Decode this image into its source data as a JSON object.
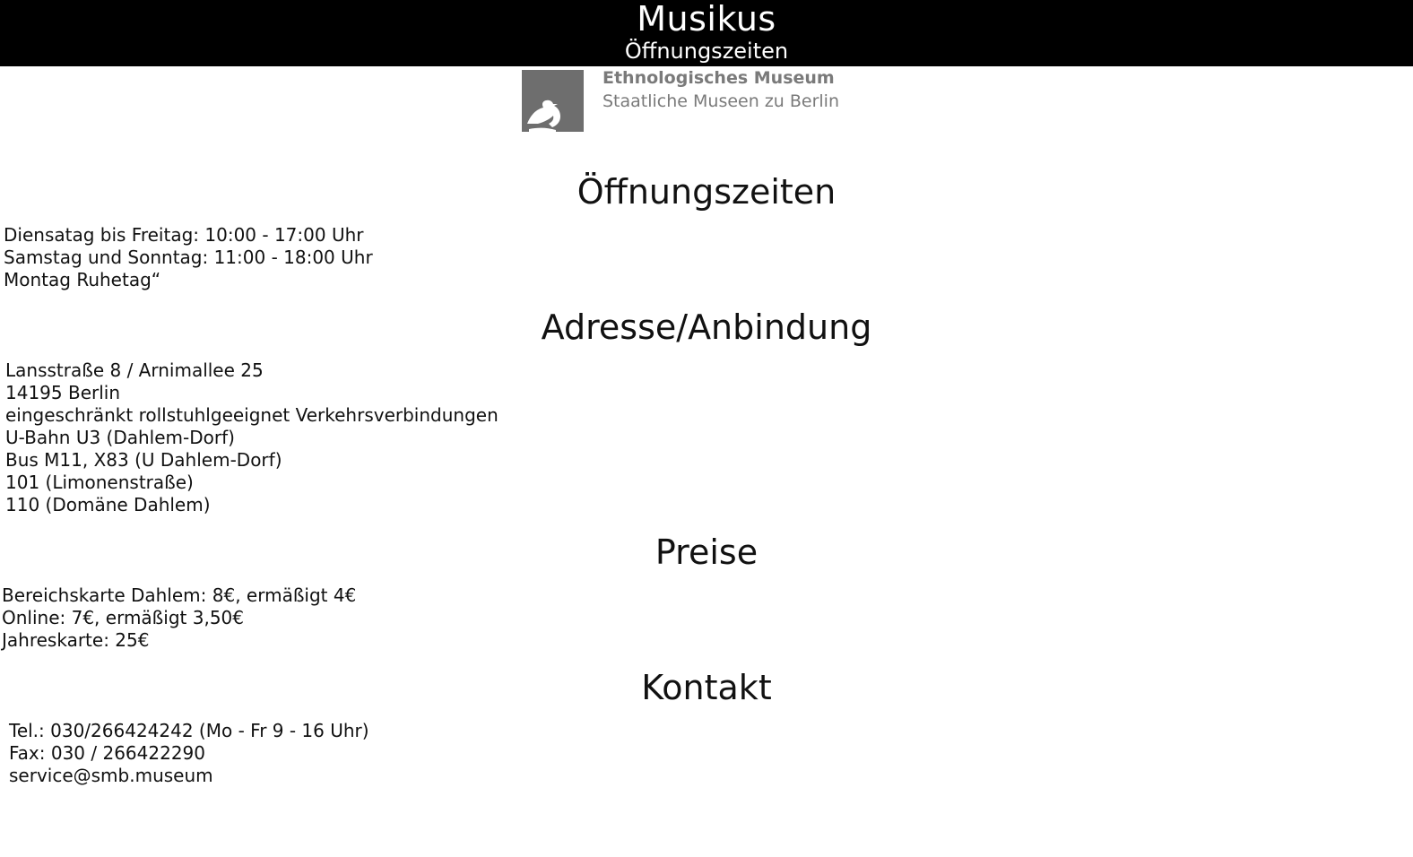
{
  "header": {
    "title": "Musikus",
    "subtitle": "Öffnungszeiten"
  },
  "logo": {
    "name": "Ethnologisches Museum",
    "organization": "Staatliche Museen zu Berlin",
    "icon": "eagle-logo-icon"
  },
  "sections": {
    "hours": {
      "heading": "Öffnungszeiten",
      "lines": [
        "Diensatag bis Freitag: 10:00 - 17:00 Uhr",
        "Samstag und Sonntag: 11:00 - 18:00 Uhr",
        "Montag Ruhetag“"
      ]
    },
    "address": {
      "heading": "Adresse/Anbindung",
      "lines": [
        "Lansstraße 8 / Arnimallee 25",
        "14195 Berlin",
        "eingeschränkt rollstuhlgeeignet Verkehrsverbindungen",
        "U-Bahn U3 (Dahlem-Dorf)",
        "Bus M11, X83 (U Dahlem-Dorf)",
        "101 (Limonenstraße)",
        "110 (Domäne Dahlem)"
      ]
    },
    "prices": {
      "heading": "Preise",
      "lines": [
        "Bereichskarte Dahlem: 8€, ermäßigt 4€",
        "Online: 7€, ermäßigt 3,50€",
        "Jahreskarte: 25€"
      ]
    },
    "contact": {
      "heading": "Kontakt",
      "lines": [
        "Tel.: 030/266424242 (Mo - Fr 9 - 16 Uhr)",
        "Fax: 030 / 266422290",
        "service@smb.museum"
      ]
    }
  },
  "colors": {
    "header_bg": "#000000",
    "header_text": "#ffffff",
    "logo_gray": "#7a7a7a"
  }
}
